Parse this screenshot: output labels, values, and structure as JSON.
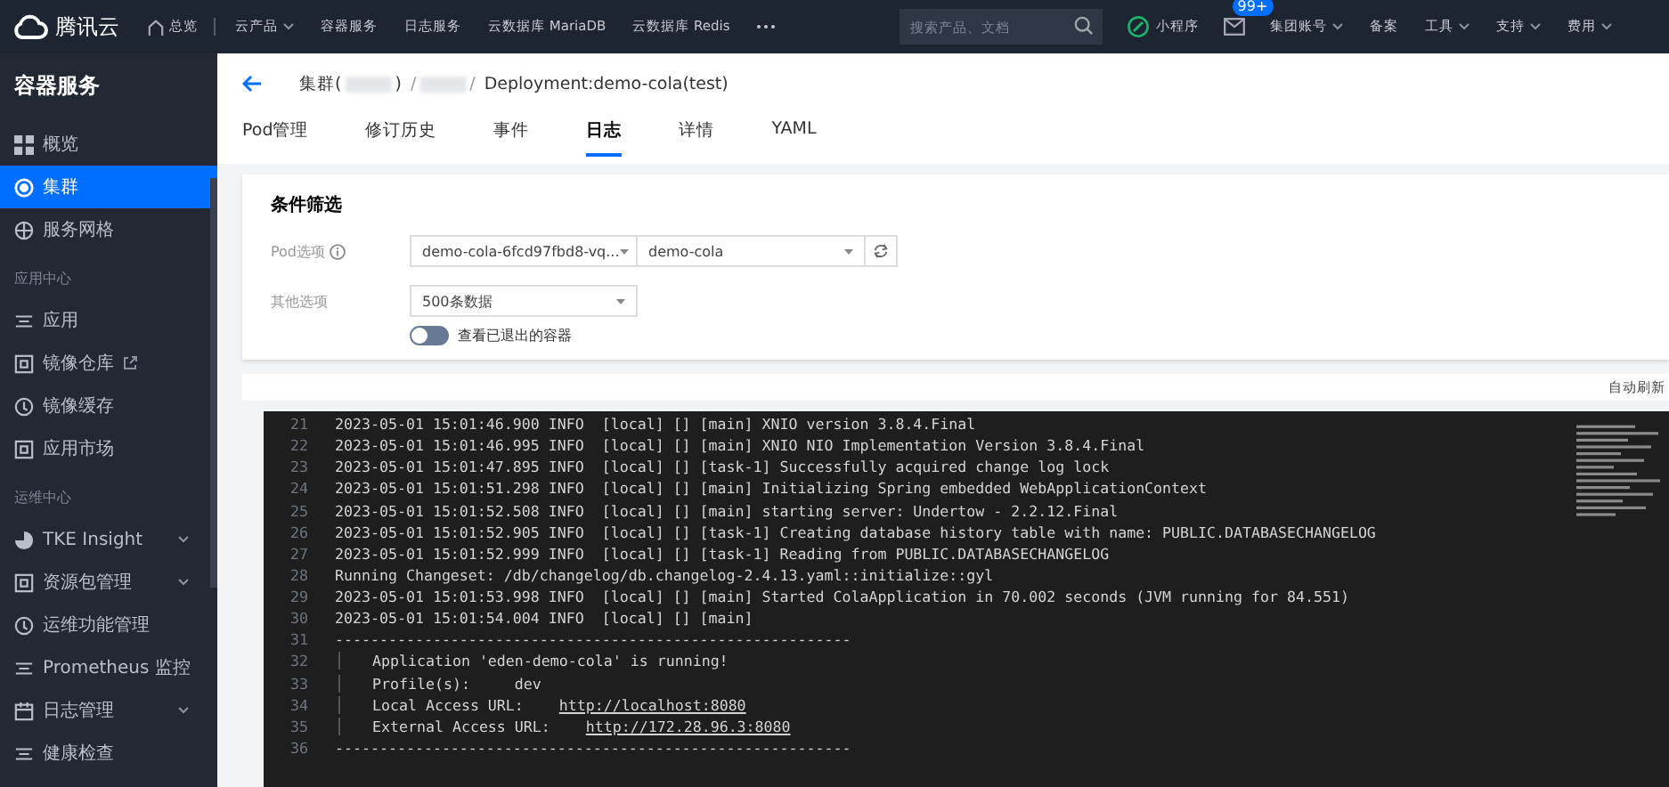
{
  "topbar": {
    "brand": "腾讯云",
    "home": "总览",
    "nav": [
      {
        "label": "云产品",
        "dropdown": true
      },
      {
        "label": "容器服务",
        "dropdown": false
      },
      {
        "label": "日志服务",
        "dropdown": false
      },
      {
        "label": "云数据库 MariaDB",
        "dropdown": false
      },
      {
        "label": "云数据库 Redis",
        "dropdown": false
      }
    ],
    "search": {
      "placeholder": "搜索产品、文档"
    },
    "mini_program": "小程序",
    "mail_badge": "99+",
    "right": [
      {
        "label": "集团账号",
        "dropdown": true
      },
      {
        "label": "备案",
        "dropdown": false
      },
      {
        "label": "工具",
        "dropdown": true
      },
      {
        "label": "支持",
        "dropdown": true
      },
      {
        "label": "费用",
        "dropdown": true
      }
    ]
  },
  "sidebar": {
    "title": "容器服务",
    "sections": [
      {
        "items": [
          {
            "label": "概览",
            "selected": false,
            "expandable": false,
            "external": false
          },
          {
            "label": "集群",
            "selected": true,
            "expandable": false,
            "external": false
          },
          {
            "label": "服务网格",
            "selected": false,
            "expandable": false,
            "external": false
          }
        ]
      },
      {
        "heading": "应用中心",
        "items": [
          {
            "label": "应用",
            "selected": false,
            "expandable": false,
            "external": false
          },
          {
            "label": "镜像仓库",
            "selected": false,
            "expandable": false,
            "external": true
          },
          {
            "label": "镜像缓存",
            "selected": false,
            "expandable": false,
            "external": false
          },
          {
            "label": "应用市场",
            "selected": false,
            "expandable": false,
            "external": false
          }
        ]
      },
      {
        "heading": "运维中心",
        "items": [
          {
            "label": "TKE Insight",
            "selected": false,
            "expandable": true,
            "external": false
          },
          {
            "label": "资源包管理",
            "selected": false,
            "expandable": true,
            "external": false
          },
          {
            "label": "运维功能管理",
            "selected": false,
            "expandable": false,
            "external": false
          },
          {
            "label": "Prometheus 监控",
            "selected": false,
            "expandable": false,
            "external": false
          },
          {
            "label": "日志管理",
            "selected": false,
            "expandable": true,
            "external": false
          },
          {
            "label": "健康检查",
            "selected": false,
            "expandable": false,
            "external": false
          }
        ]
      }
    ]
  },
  "breadcrumb": {
    "separator": "/",
    "items": [
      {
        "kind": "redacted",
        "before": "集群(",
        "after": ")"
      },
      {
        "kind": "redacted"
      },
      {
        "kind": "text",
        "text": "Deployment:demo-cola(test)"
      }
    ]
  },
  "tabs": [
    {
      "label": "Pod管理",
      "selected": false
    },
    {
      "label": "修订历史",
      "selected": false
    },
    {
      "label": "事件",
      "selected": false
    },
    {
      "label": "日志",
      "selected": true
    },
    {
      "label": "详情",
      "selected": false
    },
    {
      "label": "YAML",
      "selected": false
    }
  ],
  "filter": {
    "title": "条件筛选",
    "pod_label": "Pod选项",
    "pod_select": "demo-cola-6fcd97fbd8-vq...",
    "container_select": "demo-cola",
    "other_label": "其他选项",
    "count_select": "500条数据",
    "exited_toggle": {
      "label": "查看已退出的容器",
      "on": false
    }
  },
  "auto_refresh": "自动刷新",
  "log": [
    {
      "no": "21",
      "text": "2023-05-01 15:01:46.900 INFO  [local] [] [main] XNIO version 3.8.4.Final"
    },
    {
      "no": "22",
      "text": "2023-05-01 15:01:46.995 INFO  [local] [] [main] XNIO NIO Implementation Version 3.8.4.Final"
    },
    {
      "no": "23",
      "text": "2023-05-01 15:01:47.895 INFO  [local] [] [task-1] Successfully acquired change log lock"
    },
    {
      "no": "24",
      "text": "2023-05-01 15:01:51.298 INFO  [local] [] [main] Initializing Spring embedded WebApplicationContext"
    },
    {
      "no": "25",
      "text": "2023-05-01 15:01:52.508 INFO  [local] [] [main] starting server: Undertow - 2.2.12.Final"
    },
    {
      "no": "26",
      "text": "2023-05-01 15:01:52.905 INFO  [local] [] [task-1] Creating database history table with name: PUBLIC.DATABASECHANGELOG"
    },
    {
      "no": "27",
      "text": "2023-05-01 15:01:52.999 INFO  [local] [] [task-1] Reading from PUBLIC.DATABASECHANGELOG"
    },
    {
      "no": "28",
      "text": "Running Changeset: /db/changelog/db.changelog-2.4.13.yaml::initialize::gyl"
    },
    {
      "no": "29",
      "text": "2023-05-01 15:01:53.998 INFO  [local] [] [main] Started ColaApplication in 70.002 seconds (JVM running for 84.551)"
    },
    {
      "no": "30",
      "text": "2023-05-01 15:01:54.004 INFO  [local] [] [main]"
    },
    {
      "no": "31",
      "text": "----------------------------------------------------------"
    },
    {
      "no": "32",
      "indent": true,
      "text": "Application 'eden-demo-cola' is running!"
    },
    {
      "no": "33",
      "indent": true,
      "text": "Profile(s):     dev"
    },
    {
      "no": "34",
      "indent": true,
      "text": "Local Access URL:    ",
      "link": "http://localhost:8080"
    },
    {
      "no": "35",
      "indent": true,
      "text": "External Access URL:    ",
      "link": "http://172.28.96.3:8080"
    },
    {
      "no": "36",
      "text": "----------------------------------------------------------"
    }
  ]
}
